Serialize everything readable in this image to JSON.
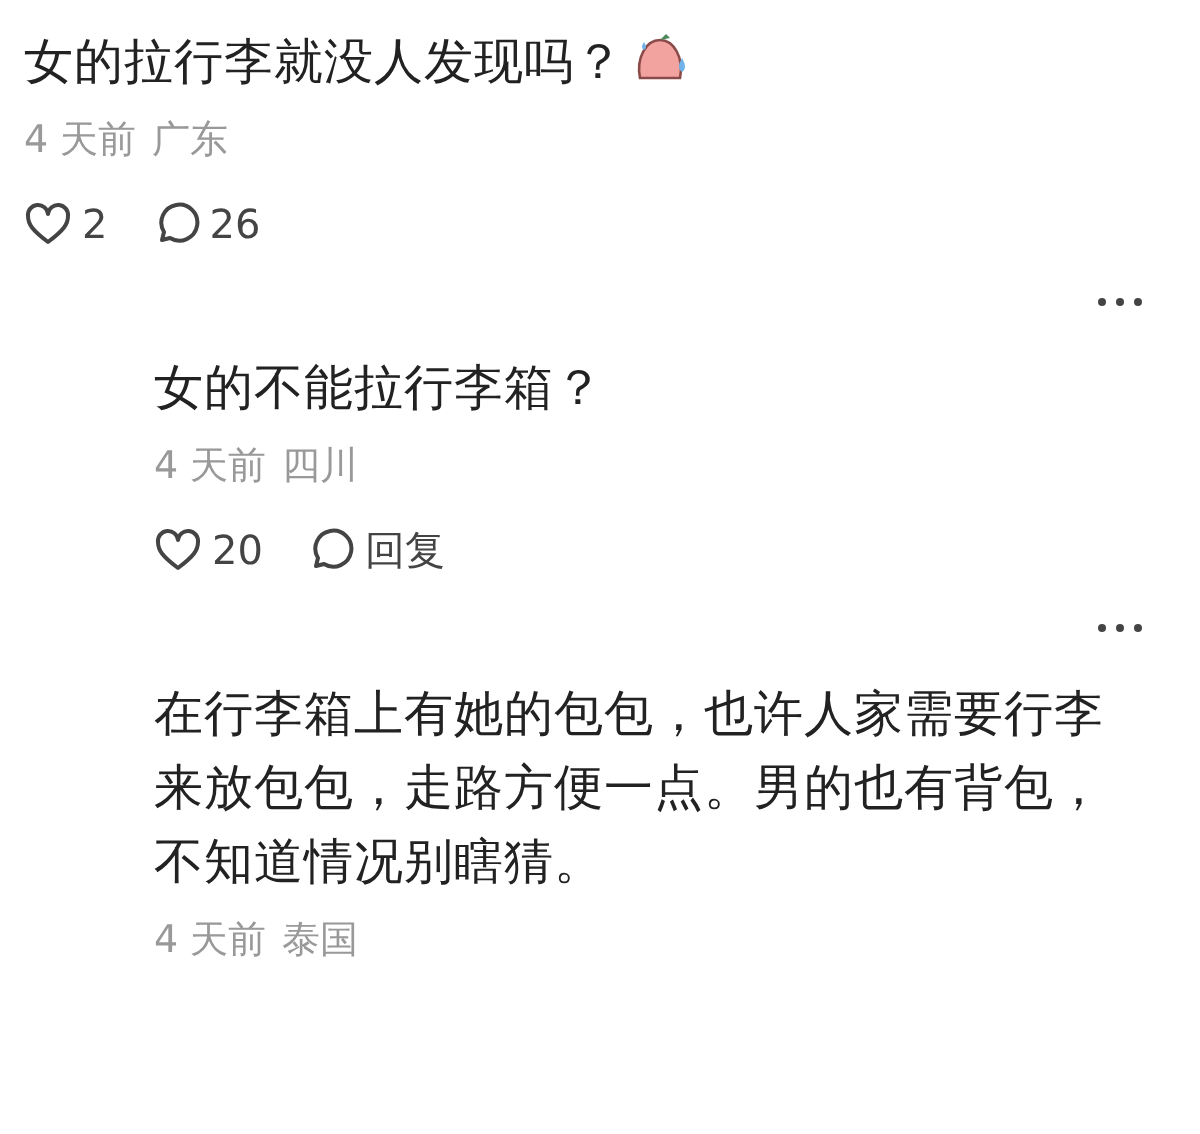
{
  "comments": [
    {
      "kind": "main",
      "text": "女的拉行李就没人发现吗？",
      "emoji": true,
      "time": "4 天前",
      "location": "广东",
      "likes": "2",
      "replies": "26"
    },
    {
      "kind": "reply",
      "text": "女的不能拉行李箱？",
      "emoji": false,
      "time": "4 天前",
      "location": "四川",
      "likes": "20",
      "replies": "回复"
    },
    {
      "kind": "reply",
      "text": "在行李箱上有她的包包，也许人家需要行李来放包包，走路方便一点。男的也有背包，不知道情况别瞎猜。",
      "emoji": false,
      "time": "4 天前",
      "location": "泰国"
    }
  ]
}
